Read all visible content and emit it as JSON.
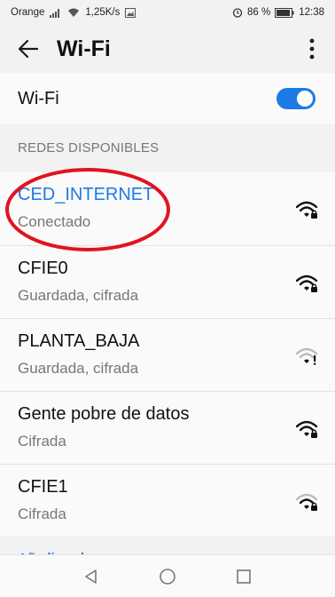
{
  "status_bar": {
    "carrier": "Orange",
    "net_speed": "1,25K/s",
    "battery_percent": "86 %",
    "time": "12:38"
  },
  "app_bar": {
    "title": "Wi-Fi"
  },
  "wifi_toggle": {
    "label": "Wi-Fi",
    "enabled": true,
    "accent_color": "#1d7ae6"
  },
  "networks_section": {
    "header": "REDES DISPONIBLES",
    "items": [
      {
        "ssid": "CED_INTERNET",
        "status": "Conectado",
        "signal": "full-secured",
        "connected": true
      },
      {
        "ssid": "CFIE0",
        "status": "Guardada, cifrada",
        "signal": "full-secured",
        "connected": false
      },
      {
        "ssid": "PLANTA_BAJA",
        "status": "Guardada, cifrada",
        "signal": "weak-warning",
        "connected": false
      },
      {
        "ssid": "Gente pobre de datos",
        "status": "Cifrada",
        "signal": "full-secured",
        "connected": false
      },
      {
        "ssid": "CFIE1",
        "status": "Cifrada",
        "signal": "medium-secured",
        "connected": false
      }
    ]
  },
  "add_network": {
    "label": "Añadir red"
  },
  "annotation": {
    "color": "#e0141e"
  }
}
